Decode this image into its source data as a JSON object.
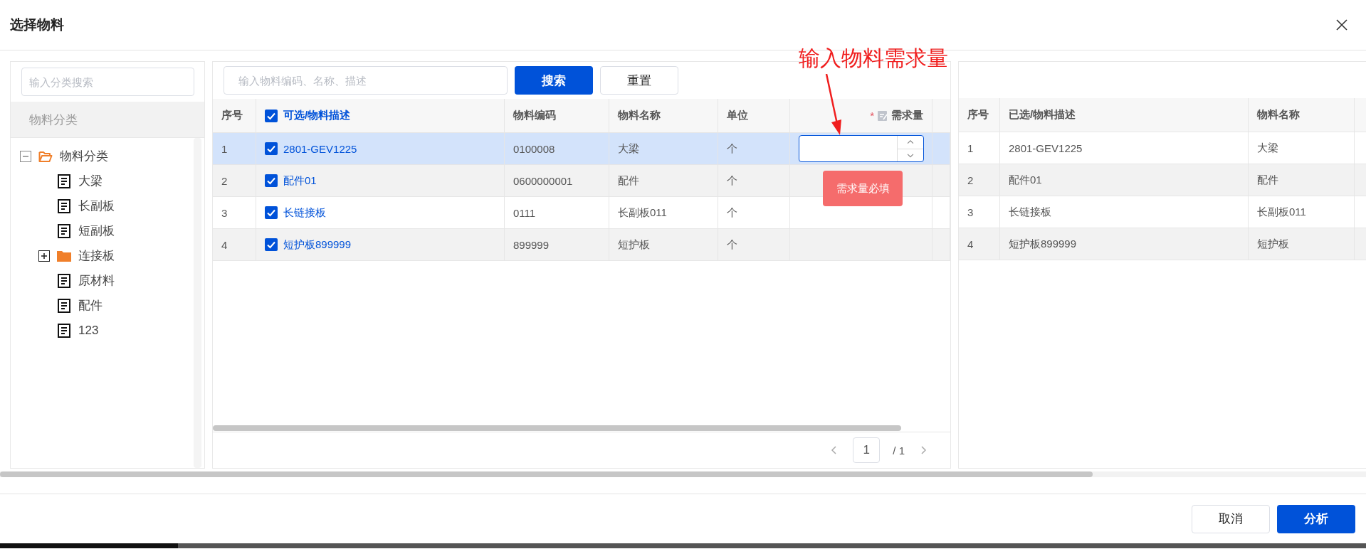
{
  "dialog": {
    "title": "选择物料"
  },
  "category_panel": {
    "search_placeholder": "输入分类搜索",
    "header": "物料分类",
    "tree": [
      {
        "label": "物料分类",
        "kind": "folder",
        "expanded": true,
        "children": [
          {
            "label": "大梁",
            "kind": "leaf"
          },
          {
            "label": "长副板",
            "kind": "leaf"
          },
          {
            "label": "短副板",
            "kind": "leaf"
          },
          {
            "label": "连接板",
            "kind": "folder",
            "expanded": false
          },
          {
            "label": "原材料",
            "kind": "leaf"
          },
          {
            "label": "配件",
            "kind": "leaf"
          },
          {
            "label": "123",
            "kind": "leaf"
          }
        ]
      }
    ]
  },
  "material_search": {
    "placeholder": "输入物料编码、名称、描述",
    "buttons": [
      {
        "label": "搜索",
        "kind": "primary"
      },
      {
        "label": "重置",
        "kind": "default"
      }
    ]
  },
  "available_table": {
    "columns": [
      "序号",
      "可选/物料描述",
      "物料编码",
      "物料名称",
      "单位",
      "需求量"
    ],
    "header_checked": true,
    "required_mark": "*",
    "validation_message": "需求量必填",
    "rows": [
      {
        "index": "1",
        "checked": true,
        "selected": true,
        "editing": true,
        "description": "2801-GEV1225",
        "code": "0100008",
        "name": "大梁",
        "unit": "个"
      },
      {
        "index": "2",
        "checked": true,
        "selected": false,
        "editing": false,
        "description": "配件01",
        "code": "0600000001",
        "name": "配件",
        "unit": "个"
      },
      {
        "index": "3",
        "checked": true,
        "selected": false,
        "editing": false,
        "description": "长链接板",
        "code": "0111",
        "name": "长副板011",
        "unit": "个"
      },
      {
        "index": "4",
        "checked": true,
        "selected": false,
        "editing": false,
        "description": "短护板899999",
        "code": "899999",
        "name": "短护板",
        "unit": "个"
      }
    ]
  },
  "pagination": {
    "page": "1",
    "total": "/ 1"
  },
  "selected_table": {
    "columns": [
      "序号",
      "已选/物料描述",
      "物料名称"
    ],
    "rows": [
      {
        "index": "1",
        "description": "2801-GEV1225",
        "name": "大梁"
      },
      {
        "index": "2",
        "description": "配件01",
        "name": "配件"
      },
      {
        "index": "3",
        "description": "长链接板",
        "name": "长副板011"
      },
      {
        "index": "4",
        "description": "短护板899999",
        "name": "短护板"
      }
    ]
  },
  "annotation": {
    "text": "输入物料需求量"
  },
  "footer": {
    "buttons": [
      {
        "label": "取消",
        "kind": "default"
      },
      {
        "label": "分析",
        "kind": "primary"
      }
    ]
  }
}
